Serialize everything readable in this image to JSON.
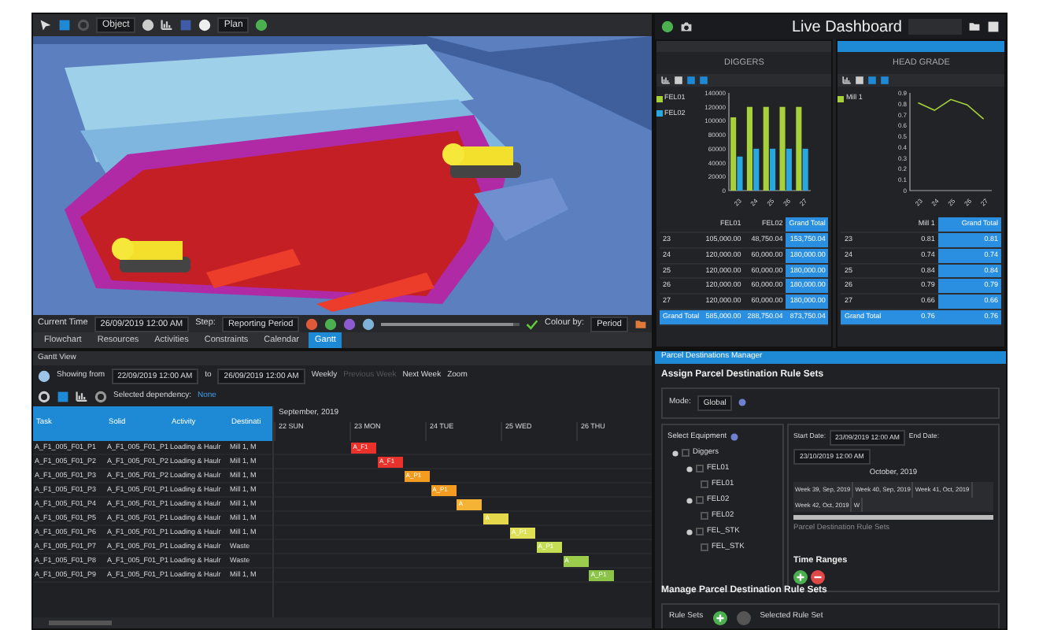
{
  "toolbar": {
    "mode": "Object",
    "view": "Plan"
  },
  "time_bar": {
    "slider": {
      "level": 0.95
    },
    "label": "Current Time",
    "time": "26/09/2019 12:00 AM",
    "step_label": "Step:",
    "step": "Reporting Period",
    "colour_label": "Colour by:",
    "colour": "Period"
  },
  "tabs": [
    {
      "label": "Flowchart",
      "selected": false
    },
    {
      "label": "Resources",
      "selected": false
    },
    {
      "label": "Activities",
      "selected": false
    },
    {
      "label": "Constraints",
      "selected": false
    },
    {
      "label": "Calendar",
      "selected": false
    },
    {
      "label": "Gantt",
      "selected": true
    }
  ],
  "dashboard": {
    "title": "Live Dashboard",
    "panels": [
      {
        "title": "DIGGERS",
        "chart_data": {
          "type": "bar",
          "categories": [
            "23",
            "24",
            "25",
            "26",
            "27"
          ],
          "series": [
            {
              "name": "FEL01",
              "color": "#a6d13a",
              "values": [
                105000,
                120000,
                120000,
                120000,
                120000
              ]
            },
            {
              "name": "FEL02",
              "color": "#29a8e0",
              "values": [
                48750,
                60000,
                60000,
                60000,
                60000
              ]
            }
          ],
          "ylim": [
            0,
            140000
          ],
          "yticks": [
            0,
            20000,
            40000,
            60000,
            80000,
            100000,
            120000,
            140000
          ]
        },
        "table": {
          "columns": [
            "",
            "FEL01",
            "FEL02",
            "Grand Total"
          ],
          "rows": [
            [
              "23",
              "105,000.00",
              "48,750.04",
              "153,750.04"
            ],
            [
              "24",
              "120,000.00",
              "60,000.00",
              "180,000.00"
            ],
            [
              "25",
              "120,000.00",
              "60,000.00",
              "180,000.00"
            ],
            [
              "26",
              "120,000.00",
              "60,000.00",
              "180,000.00"
            ],
            [
              "27",
              "120,000.00",
              "60,000.00",
              "180,000.00"
            ]
          ],
          "total": [
            "Grand Total",
            "585,000.00",
            "288,750.04",
            "873,750.04"
          ]
        }
      },
      {
        "title": "HEAD GRADE",
        "chart_data": {
          "type": "line",
          "categories": [
            "23",
            "24",
            "25",
            "26",
            "27"
          ],
          "series": [
            {
              "name": "Mill 1",
              "color": "#a6d13a",
              "values": [
                0.81,
                0.74,
                0.84,
                0.79,
                0.66
              ]
            }
          ],
          "ylim": [
            0,
            0.9
          ],
          "yticks": [
            0,
            0.1,
            0.2,
            0.3,
            0.4,
            0.5,
            0.6,
            0.7,
            0.8,
            0.9
          ]
        },
        "table": {
          "columns": [
            "",
            "Mill 1",
            "Grand Total"
          ],
          "rows": [
            [
              "23",
              "0.81",
              "0.81"
            ],
            [
              "24",
              "0.74",
              "0.74"
            ],
            [
              "25",
              "0.84",
              "0.84"
            ],
            [
              "26",
              "0.79",
              "0.79"
            ],
            [
              "27",
              "0.66",
              "0.66"
            ]
          ],
          "total": [
            "Grand Total",
            "0.76",
            "0.76"
          ]
        }
      }
    ]
  },
  "gantt": {
    "title": "Gantt View",
    "from_label": "Showing from",
    "from": "22/09/2019 12:00 AM",
    "to_label": "to",
    "to": "26/09/2019 12:00 AM",
    "period": "Weekly",
    "prev": {
      "label": "Previous Week",
      "disabled": true
    },
    "next": {
      "label": "Next Week",
      "disabled": false
    },
    "zoom": "Zoom",
    "dependency_label": "Selected dependency:",
    "dependency": "None",
    "columns": [
      "Task",
      "Solid",
      "Activity",
      "Destinati"
    ],
    "month": "September, 2019",
    "days": [
      "22 SUN",
      "23 MON",
      "24 TUE",
      "25 WED",
      "26 THU"
    ],
    "rows": [
      {
        "task": "A_F1_005_F01_P1",
        "solid": "A_F1_005_F01_P1",
        "activity": "Loading & Haulr",
        "destination": "Mill 1, M",
        "bar": {
          "label": "A_F1",
          "color": "#e8322b"
        }
      },
      {
        "task": "A_F1_005_F01_P2",
        "solid": "A_F1_005_F01_P2",
        "activity": "Loading & Haulr",
        "destination": "Mill 1, M",
        "bar": {
          "label": "A_F1",
          "color": "#e8322b"
        }
      },
      {
        "task": "A_F1_005_F01_P3",
        "solid": "A_F1_005_F01_P2",
        "activity": "Loading & Haulr",
        "destination": "Mill 1, M",
        "bar": {
          "label": "A_P1",
          "color": "#f39c1f"
        }
      },
      {
        "task": "A_F1_005_F01_P3",
        "solid": "A_F1_005_F01_P1",
        "activity": "Loading & Haulr",
        "destination": "Mill 1, M",
        "bar": {
          "label": "A_P1",
          "color": "#f39c1f"
        }
      },
      {
        "task": "A_F1_005_F01_P4",
        "solid": "A_F1_005_F01_P1",
        "activity": "Loading & Haulr",
        "destination": "Mill 1, M",
        "bar": {
          "label": "A",
          "color": "#f5b335"
        }
      },
      {
        "task": "A_F1_005_F01_P5",
        "solid": "A_F1_005_F01_P1",
        "activity": "Loading & Haulr",
        "destination": "Mill 1, M",
        "bar": {
          "label": "A",
          "color": "#e3d94a"
        }
      },
      {
        "task": "A_F1_005_F01_P6",
        "solid": "A_F1_005_F01_P1",
        "activity": "Loading & Haulr",
        "destination": "Mill 1, M",
        "bar": {
          "label": "A_P1",
          "color": "#dfe055"
        }
      },
      {
        "task": "A_F1_005_F01_P7",
        "solid": "A_F1_005_F01_P1",
        "activity": "Loading & Haulr",
        "destination": "Waste",
        "bar": {
          "label": "A_P1",
          "color": "#c5dc55"
        }
      },
      {
        "task": "A_F1_005_F01_P8",
        "solid": "A_F1_005_F01_P1",
        "activity": "Loading & Haulr",
        "destination": "Waste",
        "bar": {
          "label": "A",
          "color": "#9ccc4c"
        }
      },
      {
        "task": "A_F1_005_F01_P9",
        "solid": "A_F1_005_F01_P1",
        "activity": "Loading & Haulr",
        "destination": "Mill 1, M",
        "bar": {
          "label": "A_P1",
          "color": "#8cc44a"
        }
      }
    ]
  },
  "parcel": {
    "title": "Parcel Destinations Manager",
    "assign_heading": "Assign Parcel Destination Rule Sets",
    "mode_label": "Mode:",
    "mode": "Global",
    "equipment_label": "Select Equipment",
    "tree": [
      {
        "label": "Diggers",
        "checked": false,
        "expanded": true,
        "children": [
          {
            "label": "FEL01",
            "checked": false,
            "expanded": true,
            "children": [
              {
                "label": "FEL01",
                "checked": false
              }
            ]
          },
          {
            "label": "FEL02",
            "checked": false,
            "expanded": true,
            "children": [
              {
                "label": "FEL02",
                "checked": false
              }
            ]
          },
          {
            "label": "FEL_STK",
            "checked": false,
            "expanded": true,
            "children": [
              {
                "label": "FEL_STK",
                "checked": false
              }
            ]
          }
        ]
      }
    ],
    "start_label": "Start Date:",
    "start": "23/09/2019 12:00 AM",
    "end_label": "End Date:",
    "end": "23/10/2019 12:00 AM",
    "month": "October, 2019",
    "weeks": [
      "Week 39, Sep, 2019",
      "Week 40, Sep, 2019",
      "Week 41, Oct, 2019",
      "Week 42, Oct, 2019",
      "W"
    ],
    "rule_sets_row": "Parcel Destination Rule Sets",
    "time_ranges": "Time Ranges",
    "manage_heading": "Manage Parcel Destination Rule Sets",
    "rule_sets_label": "Rule Sets",
    "selected_rule_set": "Selected Rule Set"
  }
}
